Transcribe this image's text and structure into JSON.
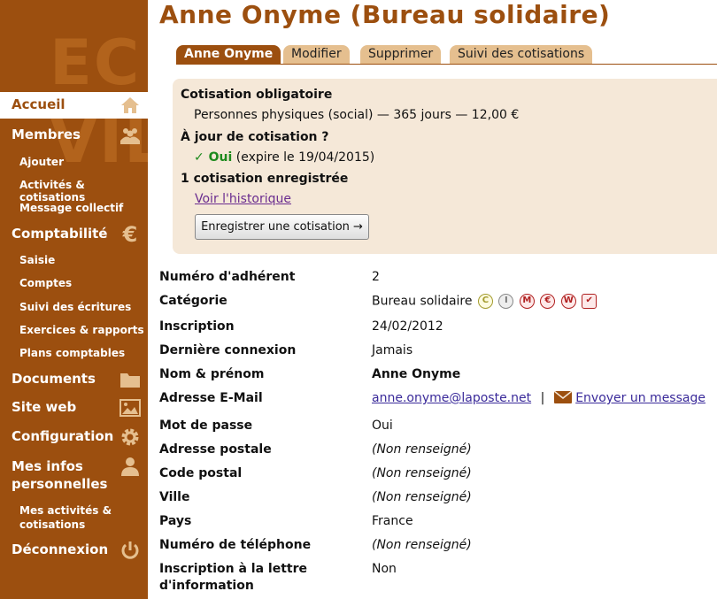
{
  "logo": {
    "line1": "EC",
    "line2": "VIL"
  },
  "nav": {
    "accueil": "Accueil",
    "membres": "Membres",
    "membres_sub": [
      "Ajouter",
      "Activités & cotisations",
      "Message collectif"
    ],
    "compta": "Comptabilité",
    "compta_sub": [
      "Saisie",
      "Comptes",
      "Suivi des écritures",
      "Exercices & rapports",
      "Plans comptables"
    ],
    "documents": "Documents",
    "siteweb": "Site web",
    "config": "Configuration",
    "mesinfos": "Mes infos personnelles",
    "mesinfos_sub": "Mes activités & cotisations",
    "deconnexion": "Déconnexion"
  },
  "page": {
    "title": "Anne Onyme (Bureau solidaire)"
  },
  "tabs": [
    "Anne Onyme",
    "Modifier",
    "Supprimer",
    "Suivi des cotisations"
  ],
  "cotisation": {
    "heading": "Cotisation obligatoire",
    "detail": "Personnes physiques (social) — 365 jours — 12,00 €",
    "status_q": "À jour de cotisation ?",
    "status_ok": "✓ Oui",
    "status_exp": "(expire le 19/04/2015)",
    "count": "1 cotisation enregistrée",
    "history_link": "Voir l'historique",
    "record_button": "Enregistrer une cotisation →"
  },
  "fields": {
    "numero": {
      "label": "Numéro d'adhérent",
      "value": "2"
    },
    "categorie": {
      "label": "Catégorie",
      "value": "Bureau solidaire",
      "badges": [
        "C",
        "I",
        "M",
        "€",
        "W",
        "✔"
      ]
    },
    "inscription": {
      "label": "Inscription",
      "value": "24/02/2012"
    },
    "connexion": {
      "label": "Dernière connexion",
      "value": "Jamais"
    },
    "nom": {
      "label": "Nom & prénom",
      "value": "Anne Onyme"
    },
    "email": {
      "label": "Adresse E-Mail",
      "value": "anne.onyme@laposte.net",
      "sep": "|",
      "send": " Envoyer un message"
    },
    "mdp": {
      "label": "Mot de passe",
      "value": "Oui"
    },
    "adresse": {
      "label": "Adresse postale",
      "value": "(Non renseigné)"
    },
    "cp": {
      "label": "Code postal",
      "value": "(Non renseigné)"
    },
    "ville": {
      "label": "Ville",
      "value": "(Non renseigné)"
    },
    "pays": {
      "label": "Pays",
      "value": "France"
    },
    "tel": {
      "label": "Numéro de téléphone",
      "value": "(Non renseigné)"
    },
    "lettre": {
      "label_1": "Inscription à la lettre",
      "label_2": "d'information",
      "value": "Non"
    }
  },
  "colors": {
    "brand": "#9c4f0f",
    "tab_inactive": "#e5bf8f",
    "box_bg": "#f5e8d8",
    "ok": "#1d8a1d"
  }
}
